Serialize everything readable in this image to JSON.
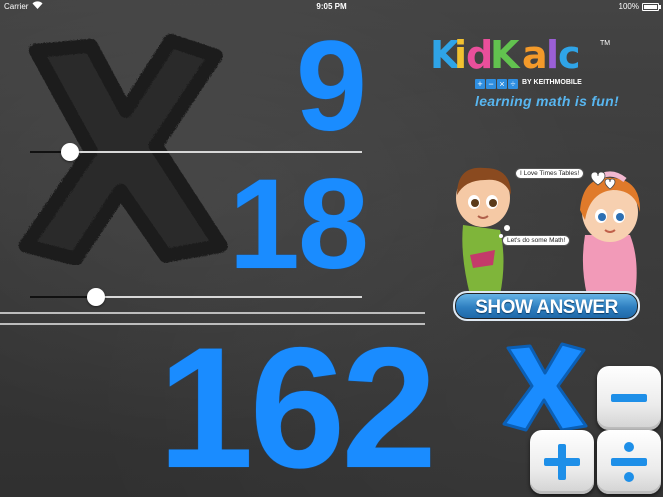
{
  "status_bar": {
    "carrier": "Carrier",
    "time": "9:05 PM",
    "battery": "100%",
    "battery_level": 1.0
  },
  "problem": {
    "operator": "multiply",
    "operand_top": "9",
    "operand_bottom": "18",
    "result": "162"
  },
  "sliders": [
    {
      "name": "top-number-slider",
      "value": 0.12
    },
    {
      "name": "bottom-number-slider",
      "value": 0.2
    }
  ],
  "logo": {
    "letters": [
      {
        "ch": "K",
        "color": "#2fa4e7"
      },
      {
        "ch": "i",
        "color": "#f2c230"
      },
      {
        "ch": "d",
        "color": "#e94f9b"
      },
      {
        "ch": "K",
        "color": "#62c24f"
      },
      {
        "ch": "a",
        "color": "#f39a2a"
      },
      {
        "ch": "l",
        "color": "#9b5fd6"
      },
      {
        "ch": "c",
        "color": "#2fa4e7"
      }
    ],
    "tm": "TM",
    "ops": [
      "+",
      "−",
      "×",
      "÷"
    ],
    "byline": "BY KEITHMOBILE",
    "tagline": "learning math is fun!"
  },
  "speech": {
    "girl": "I Love Times Tables!",
    "boy": "Let's do some Math!"
  },
  "show_answer_label": "SHOW ANSWER",
  "colors": {
    "number_blue": "#1a8cff",
    "chalkboard": "#3a3a3a",
    "button_blue": "#2e7fc0"
  },
  "operators": {
    "active": "times-icon",
    "keys": [
      "minus-icon",
      "plus-icon",
      "divide-icon"
    ]
  }
}
